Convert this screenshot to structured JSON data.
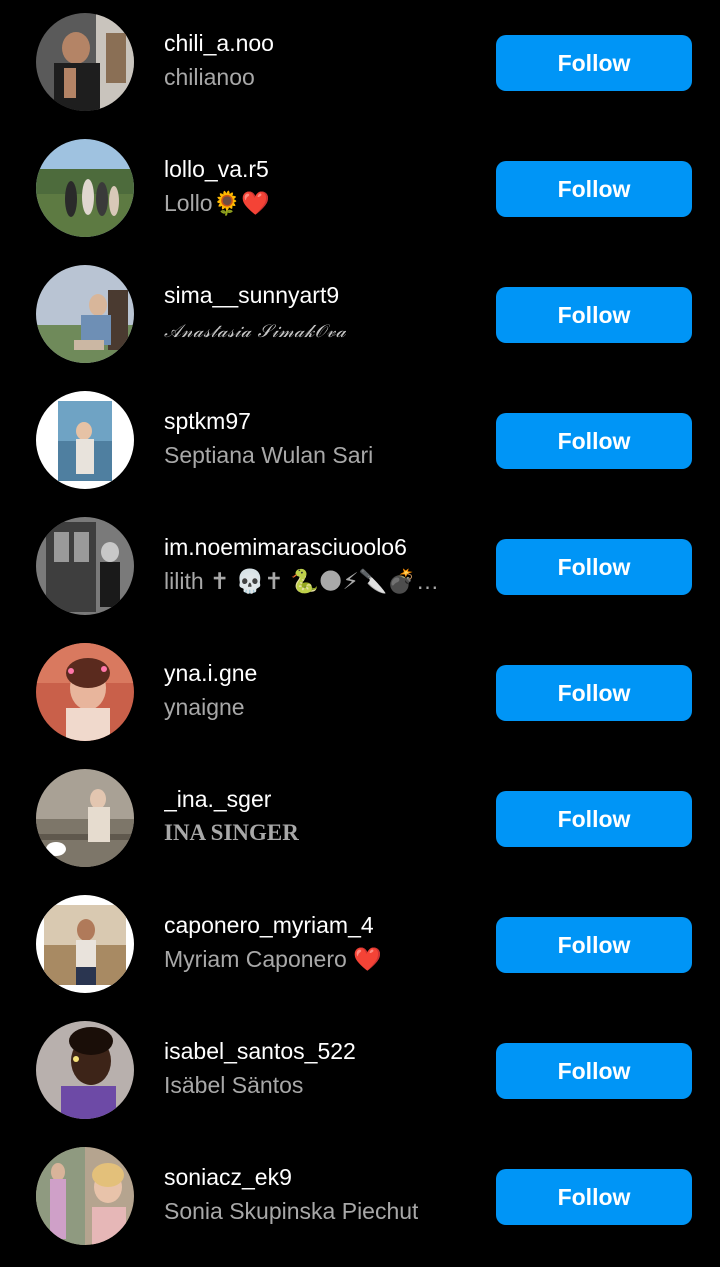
{
  "accent_color": "#0095f6",
  "background_color": "#000000",
  "accounts": [
    {
      "username": "chili_a.noo",
      "full_name": "chilianoo",
      "button": "Follow"
    },
    {
      "username": "lollo_va.r5",
      "full_name": "Lollo🌻❤️",
      "button": "Follow"
    },
    {
      "username": "sima__sunnyart9",
      "full_name": "𝒜𝓃𝒶𝓈𝓉𝒶𝓈𝒾𝒶 𝒮𝒾𝓂𝒶𝓀𝒪𝓋𝒶",
      "button": "Follow"
    },
    {
      "username": "sptkm97",
      "full_name": "Septiana Wulan Sari",
      "button": "Follow"
    },
    {
      "username": "im.noemimarasciuoolo6",
      "full_name": "lilith ✝ 💀✝ 🐍🌑⚡🔪💣…",
      "button": "Follow"
    },
    {
      "username": "yna.i.gne",
      "full_name": "ynaigne",
      "button": "Follow"
    },
    {
      "username": "_ina._sger",
      "full_name": "INA SINGER",
      "button": "Follow"
    },
    {
      "username": "caponero_myriam_4",
      "full_name": "Myriam Caponero ❤️",
      "button": "Follow"
    },
    {
      "username": "isabel_santos_522",
      "full_name": "Isäbel Säntos",
      "button": "Follow"
    },
    {
      "username": "soniacz_ek9",
      "full_name": "Sonia Skupinska Piechut",
      "button": "Follow"
    }
  ]
}
